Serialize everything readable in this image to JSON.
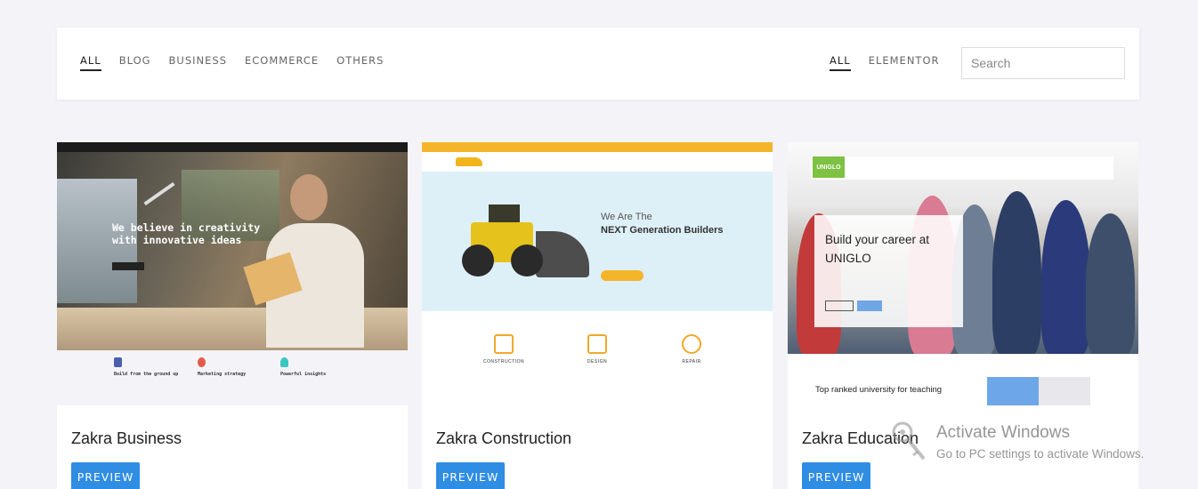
{
  "filters": {
    "categories": [
      "ALL",
      "BLOG",
      "BUSINESS",
      "ECOMMERCE",
      "OTHERS"
    ],
    "active_category": "ALL",
    "builders": [
      "ALL",
      "ELEMENTOR"
    ],
    "active_builder": "ALL",
    "search_placeholder": "Search"
  },
  "cards": [
    {
      "title": "Zakra Business",
      "preview_label": "PREVIEW",
      "thumbnail": {
        "headline_1": "We believe in creativity",
        "headline_2": "with innovative ideas",
        "features": [
          "Build from the ground up",
          "Marketing strategy",
          "Powerful insights"
        ]
      }
    },
    {
      "title": "Zakra Construction",
      "preview_label": "PREVIEW",
      "thumbnail": {
        "heading_1": "We Are The",
        "heading_2": "NEXT Generation Builders",
        "services": [
          "CONSTRUCTION",
          "DESIGN",
          "REPAIR"
        ]
      }
    },
    {
      "title": "Zakra Education",
      "preview_label": "PREVIEW",
      "thumbnail": {
        "logo": "UNIGLO",
        "heading_1": "Build your career at",
        "heading_2": "UNIGLO",
        "tagline": "Top ranked university for teaching"
      }
    }
  ],
  "watermark": {
    "title": "Activate Windows",
    "subtitle": "Go to PC settings to activate Windows."
  },
  "colors": {
    "accent": "#2f8de4",
    "page_bg": "#f3f3f8",
    "construction_yellow": "#f4b52a",
    "education_green": "#7dc243"
  }
}
